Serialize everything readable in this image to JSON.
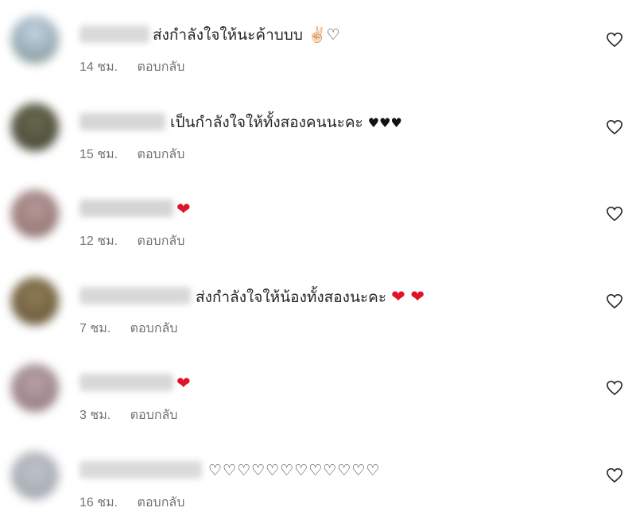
{
  "comments": [
    {
      "text": "ส่งกำลังใจให้นะค้าบบบ",
      "emoji": "✌🏻♡",
      "time": "14 ชม.",
      "reply": "ตอบกลับ"
    },
    {
      "text": "เป็นกำลังใจให้ทั้งสองคนนะคะ",
      "emoji": "♥♥♥",
      "time": "15 ชม.",
      "reply": "ตอบกลับ"
    },
    {
      "text": "",
      "emoji": "❤",
      "time": "12 ชม.",
      "reply": "ตอบกลับ"
    },
    {
      "text": "ส่งกำลังใจให้น้องทั้งสองนะคะ",
      "emoji": "❤ ❤",
      "time": "7 ชม.",
      "reply": "ตอบกลับ"
    },
    {
      "text": "",
      "emoji": "❤",
      "time": "3 ชม.",
      "reply": "ตอบกลับ"
    },
    {
      "text": "",
      "emoji": "♡♡♡♡♡♡♡♡♡♡♡♡",
      "time": "16 ชม.",
      "reply": "ตอบกลับ"
    }
  ],
  "colors": {
    "text": "#262626",
    "meta": "#737373",
    "heart_red": "#e0132a",
    "avatars": [
      "#9fb3c2",
      "#5a5a44",
      "#a08584",
      "#7a6a48",
      "#a68f93",
      "#a9aeb5"
    ]
  },
  "icons": {
    "like": "heart-outline-icon"
  }
}
